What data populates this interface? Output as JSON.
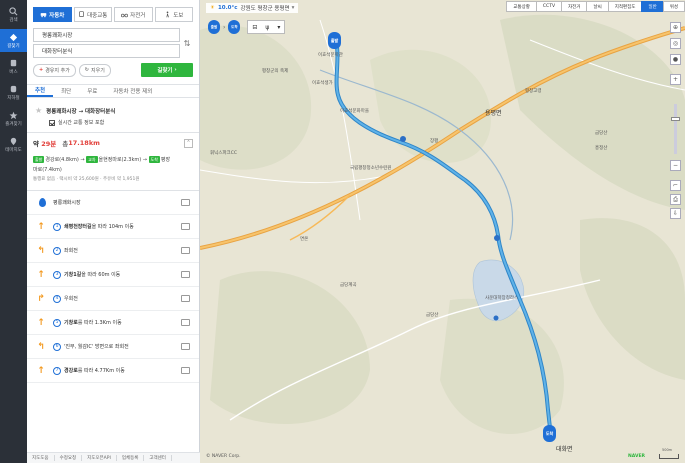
{
  "rail": [
    {
      "label": "검색",
      "icon": "search-icon"
    },
    {
      "label": "길찾기",
      "icon": "directions-icon",
      "active": true
    },
    {
      "label": "버스",
      "icon": "bus-icon"
    },
    {
      "label": "지하철",
      "icon": "subway-icon"
    },
    {
      "label": "즐겨찾기",
      "icon": "star-icon"
    },
    {
      "label": "테마지도",
      "icon": "theme-map-icon"
    }
  ],
  "modes": [
    {
      "label": "자동차",
      "icon": "car-icon",
      "active": true
    },
    {
      "label": "대중교통",
      "icon": "transit-icon"
    },
    {
      "label": "자전거",
      "icon": "bike-icon"
    },
    {
      "label": "도보",
      "icon": "walk-icon"
    }
  ],
  "origin": "평롱쾌화시장",
  "destination": "대화장터분식",
  "add_waypoint": "경유지 추가",
  "clear": "지우기",
  "search_button": "길찾기",
  "route_tabs": [
    "추천",
    "최단",
    "무료",
    "자동차 전용 제외"
  ],
  "route_title": "평롱쾌화시장 → 대화장터분식",
  "realtime": "실시간 교통 정보 포함",
  "summary": {
    "time_prefix": "약",
    "time": "29분",
    "dist_prefix": "총",
    "dist": "17.18km",
    "via_1": "경강로(4.8km) →",
    "via_2": "을현정마로(2.3km) →",
    "via_3": "평장",
    "via_4": "마로(7.4km)",
    "tag_start": "출발",
    "tag_mid": "교차",
    "tag_end": "도착",
    "costs": "통행료 없음 · 택시비 약 25,600원 · 주유비 약 1,951원"
  },
  "steps": [
    {
      "arrow": "",
      "num": "",
      "text": "평롱쾌화시장",
      "type": "start"
    },
    {
      "arrow": "↑",
      "num": "1",
      "bold": "쇄평천장터길",
      "text": "을 따라 104m 이동"
    },
    {
      "arrow": "↰",
      "num": "2",
      "bold": "",
      "text": "좌회전"
    },
    {
      "arrow": "↑",
      "num": "3",
      "bold": "기창1길",
      "text": "을 따라 60m 이동"
    },
    {
      "arrow": "↱",
      "num": "4",
      "bold": "",
      "text": "우회전"
    },
    {
      "arrow": "↑",
      "num": "5",
      "bold": "기창로",
      "text": "를 따라 1.3Km 이동"
    },
    {
      "arrow": "↰",
      "num": "6",
      "bold": "",
      "text": "'진부, 월감IC' 방면으로 좌회전"
    },
    {
      "arrow": "↑",
      "num": "7",
      "bold": "경강로",
      "text": "를 따라 4.77Km 이동"
    }
  ],
  "footer": [
    "지도도움",
    "수정요청",
    "지도오픈API",
    "업체등록",
    "고객센터"
  ],
  "map": {
    "temp": "10.0°c",
    "location": "강원도 평창군 용평면",
    "top_tabs": [
      "교통상황",
      "CCTV",
      "자전거",
      "날씨",
      "지적편집도",
      "일반",
      "위성"
    ],
    "active_tab": "일반",
    "start_label": "출발",
    "end_label": "도착",
    "labels": [
      "평창군의 축제",
      "이효석문학관",
      "이효석생가",
      "이효석문화마을",
      "용평면",
      "평창고령",
      "금당산",
      "흥정산",
      "휘닉스파크CC",
      "장평",
      "국립평창청소년수련원",
      "면온",
      "금당계곡",
      "사운대학장청라스",
      "금당산",
      "대화면"
    ],
    "copyright": "© NAVER Corp.",
    "brand": "NAVER",
    "scale": "500m"
  }
}
